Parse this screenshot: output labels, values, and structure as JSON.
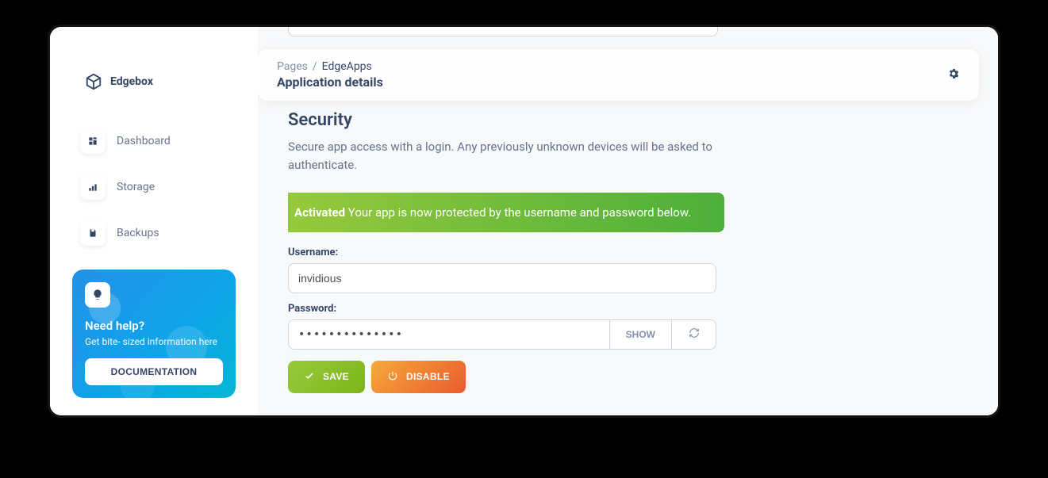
{
  "brand": {
    "name": "Edgebox"
  },
  "sidebar": {
    "items": [
      {
        "label": "Dashboard"
      },
      {
        "label": "Storage"
      },
      {
        "label": "Backups"
      }
    ],
    "help": {
      "title": "Need help?",
      "subtitle": "Get bite- sized information here",
      "button": "DOCUMENTATION"
    }
  },
  "header": {
    "crumb_root": "Pages",
    "crumb_sep": "/",
    "crumb_current": "EdgeApps",
    "page_title": "Application details"
  },
  "section": {
    "title": "Security",
    "description": "Secure app access with a login. Any previously unknown devices will be asked to authenticate."
  },
  "alert": {
    "strong": "Activated",
    "text": " Your app is now protected by the username and password below."
  },
  "form": {
    "username_label": "Username:",
    "username_value": "invidious",
    "password_label": "Password:",
    "password_value": "••••••••••••••",
    "show_label": "SHOW",
    "save_label": "SAVE",
    "disable_label": "DISABLE"
  }
}
